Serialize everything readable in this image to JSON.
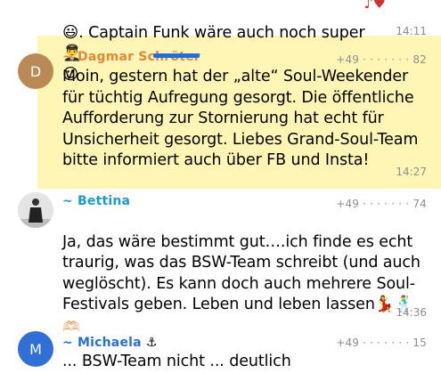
{
  "top_message": {
    "text": ". Captain Funk wäre auch noch super",
    "time": "14:11"
  },
  "messages": [
    {
      "sender": "~ Dagmar Schröter",
      "phone": "+49 · · · · · · · 82",
      "avatar_letter": "D",
      "avatar_color": "#b98a56",
      "text": "Moin, gestern hat der „alte“ Soul-Weekender\nfür tüchtig Aufregung gesorgt. Die öffentliche\nAufforderung zur Stornierung hat echt für\nUnsicherheit gesorgt. Liebes Grand-Soul-Team\nbitte informiert auch über FB und Insta!",
      "time": "14:27",
      "highlighted": true
    },
    {
      "sender": "~ Bettina",
      "phone": "+49 · · · · · · · 74",
      "text": "Ja, das wäre bestimmt gut….ich finde es echt\ntraurig, was das BSW-Team schreibt (und auch\nweglöscht). Es kann doch auch mehrere Soul-\nFestivals geben. Leben und leben lassen",
      "time": "14:36"
    },
    {
      "sender": "~ Michaela",
      "phone": "+49 · · · · · · · 15",
      "avatar_letter": "M",
      "avatar_color": "#2f6fd6",
      "text": "... BSW-Team nicht ... deutlich"
    }
  ],
  "colors": {
    "dagmar_name": "#e08a3c",
    "bettina_name": "#1a9bd7",
    "michaela_name": "#2a6fd6",
    "highlight": "#fff08a"
  }
}
